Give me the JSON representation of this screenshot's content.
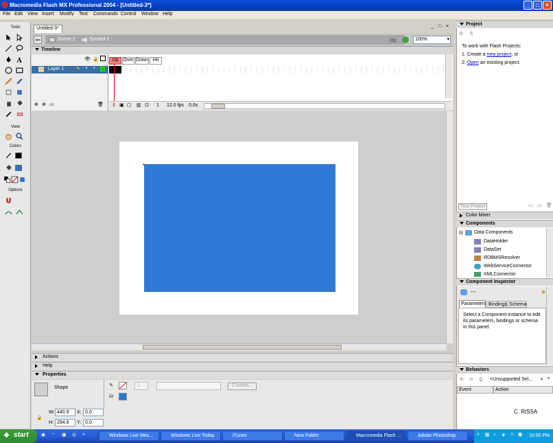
{
  "window": {
    "title": "Macromedia Flash MX Professional 2004 - [Untitled-3*]"
  },
  "menu": [
    "File",
    "Edit",
    "View",
    "Insert",
    "Modify",
    "Text",
    "Commands",
    "Control",
    "Window",
    "Help"
  ],
  "tools": {
    "header": "Tools",
    "view_label": "View",
    "colors_label": "Colors",
    "options_label": "Options"
  },
  "document": {
    "tab": "Untitled-3*",
    "scene": "Scene 1",
    "symbol": "Symbol 1",
    "zoom": "100%"
  },
  "timeline": {
    "header": "Timeline",
    "layer_name": "Layer 1",
    "frame_labels": [
      "Up",
      "Over",
      "Down",
      "Hit"
    ],
    "current_frame": "1",
    "fps": "12.0 fps",
    "elapsed": "0.0s"
  },
  "panels": {
    "actions": "Actions",
    "help": "Help",
    "properties": "Properties"
  },
  "properties": {
    "shape_label": "Shape",
    "stroke_height": "1",
    "custom_button": "Custom...",
    "w_label": "W:",
    "w_value": "440.9",
    "h_label": "H:",
    "h_value": "294.9",
    "x_label": "X:",
    "x_value": "0.0",
    "y_label": "Y:",
    "y_value": "0.0"
  },
  "project_panel": {
    "header": "Project",
    "intro": "To work with Flash Projects:",
    "step1_prefix": "1. Create a ",
    "step1_link": "new project",
    "step1_suffix": ", or",
    "step2_prefix": "2. ",
    "step2_link": "Open",
    "step2_suffix": " an existing project.",
    "test_button": "Test Project"
  },
  "color_mixer": {
    "header": "Color Mixer"
  },
  "components": {
    "header": "Components",
    "folder": "Data Components",
    "items": [
      "DataHolder",
      "DataSet",
      "RDBMSResolver",
      "WebServiceConnector",
      "XMLConnector"
    ]
  },
  "inspector": {
    "header": "Component Inspector",
    "dashes": "---",
    "tabs": [
      "Parameters",
      "Bindings",
      "Schema"
    ],
    "message": "Select a Component instance to edit its parameters, bindings or schema in this panel."
  },
  "behaviors": {
    "header": "Behaviors",
    "selection": "<Unsupported Sel...",
    "col_event": "Event",
    "col_action": "Action",
    "credit": "C. RISSA"
  },
  "taskbar": {
    "start": "start",
    "tasks": [
      "Windows Live Mes...",
      "Windows Live Today",
      "iTunes",
      "New Folder",
      "Macromedia Flash ...",
      "Adobe Photoshop"
    ],
    "time": "10:50 PM"
  },
  "colors": {
    "fill": "#2a74d0",
    "stroke": "#cc0000",
    "accent": "#0a4fd8"
  }
}
